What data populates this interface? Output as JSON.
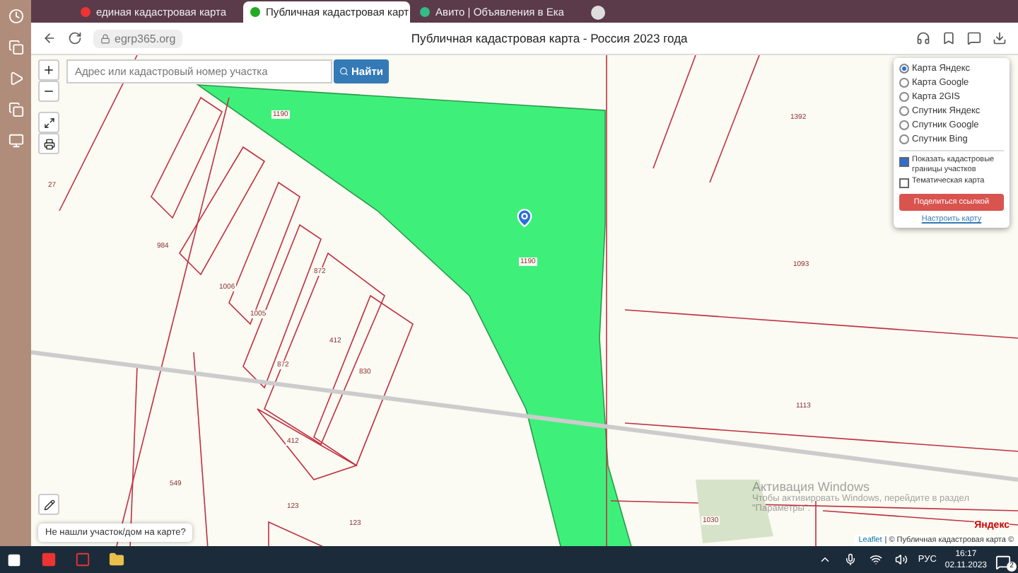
{
  "browser": {
    "tabs": [
      {
        "title": "единая кадастровая карта",
        "selected": false
      },
      {
        "title": "Публичная кадастровая карт",
        "selected": true
      },
      {
        "title": "Авито | Объявления в Ека",
        "selected": false
      }
    ],
    "url": "egrp365.org",
    "page_title": "Публичная кадастровая карта - Россия 2023 года"
  },
  "map": {
    "search": {
      "placeholder": "Адрес или кадастровый номер участка",
      "button": "Найти"
    },
    "layers": [
      {
        "label": "Карта Яндекс",
        "selected": true
      },
      {
        "label": "Карта Google",
        "selected": false
      },
      {
        "label": "Карта 2GIS",
        "selected": false
      },
      {
        "label": "Спутник Яндекс",
        "selected": false
      },
      {
        "label": "Спутник Google",
        "selected": false
      },
      {
        "label": "Спутник Bing",
        "selected": false
      }
    ],
    "options": [
      {
        "label": "Показать кадастровые границы участков",
        "checked": true
      },
      {
        "label": "Тематическая карта",
        "checked": false
      }
    ],
    "share_button": "Поделиться ссылкой",
    "settings_link": "Настроить карту",
    "parcel_labels": [
      "27",
      "1190",
      "1392",
      "984",
      "1006",
      "872",
      "1005",
      "1190",
      "1093",
      "872",
      "412",
      "830",
      "1113",
      "412",
      "549",
      "123",
      "123",
      "1030"
    ],
    "help_text": "Не нашли участок/дом на карте?",
    "logo": "Яндекс",
    "attribution_link": "Leaflet",
    "attribution": "| © Публичная кадастровая карта ©"
  },
  "activation": {
    "title": "Активация Windows",
    "body": "Чтобы активировать Windows, перейдите в раздел \"Параметры\"."
  },
  "taskbar": {
    "language": "РУС",
    "time": "16:17",
    "date": "02.11.2023",
    "notifications": "2"
  }
}
